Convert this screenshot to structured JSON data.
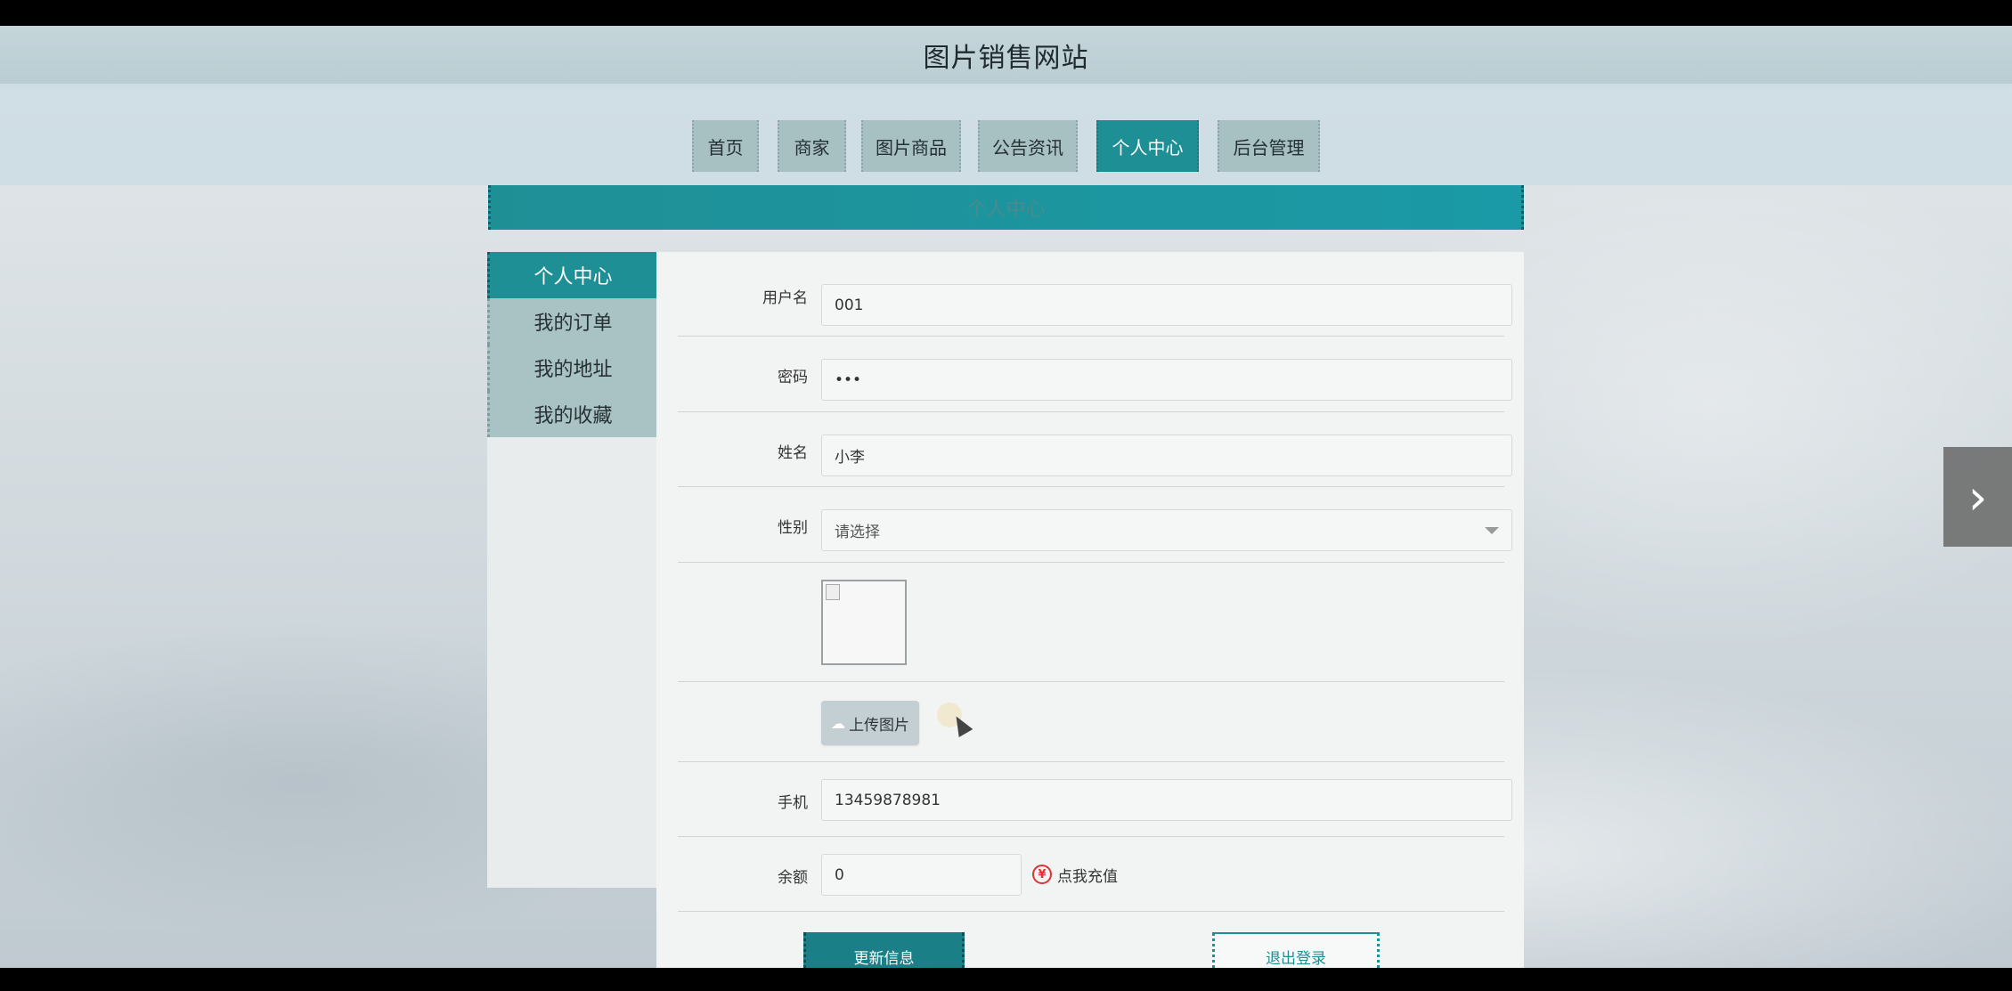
{
  "site": {
    "title": "图片销售网站"
  },
  "nav": {
    "items": [
      {
        "label": "首页",
        "active": false
      },
      {
        "label": "商家",
        "active": false
      },
      {
        "label": "图片商品",
        "active": false
      },
      {
        "label": "公告资讯",
        "active": false
      },
      {
        "label": "个人中心",
        "active": true
      },
      {
        "label": "后台管理",
        "active": false
      }
    ]
  },
  "section": {
    "title": "个人中心"
  },
  "sidebar": {
    "items": [
      {
        "label": "个人中心",
        "active": true
      },
      {
        "label": "我的订单",
        "active": false
      },
      {
        "label": "我的地址",
        "active": false
      },
      {
        "label": "我的收藏",
        "active": false
      }
    ]
  },
  "form": {
    "username": {
      "label": "用户名",
      "value": "001"
    },
    "password": {
      "label": "密码",
      "value": "•••"
    },
    "name": {
      "label": "姓名",
      "value": "小李"
    },
    "gender": {
      "label": "性别",
      "placeholder": "请选择"
    },
    "upload": {
      "label": "上传图片",
      "icon": "cloud-upload-icon"
    },
    "phone": {
      "label": "手机",
      "value": "13459878981"
    },
    "balance": {
      "label": "余额",
      "value": "0",
      "recharge_label": "点我充值",
      "recharge_icon": "yen-icon",
      "recharge_symbol": "¥"
    },
    "update_label": "更新信息",
    "logout_label": "退出登录"
  },
  "colors": {
    "accent": "#1f8f96",
    "nav_bg": "#a7c0c2"
  },
  "carousel": {
    "next_icon": "chevron-right-icon",
    "next_glyph": "›"
  }
}
